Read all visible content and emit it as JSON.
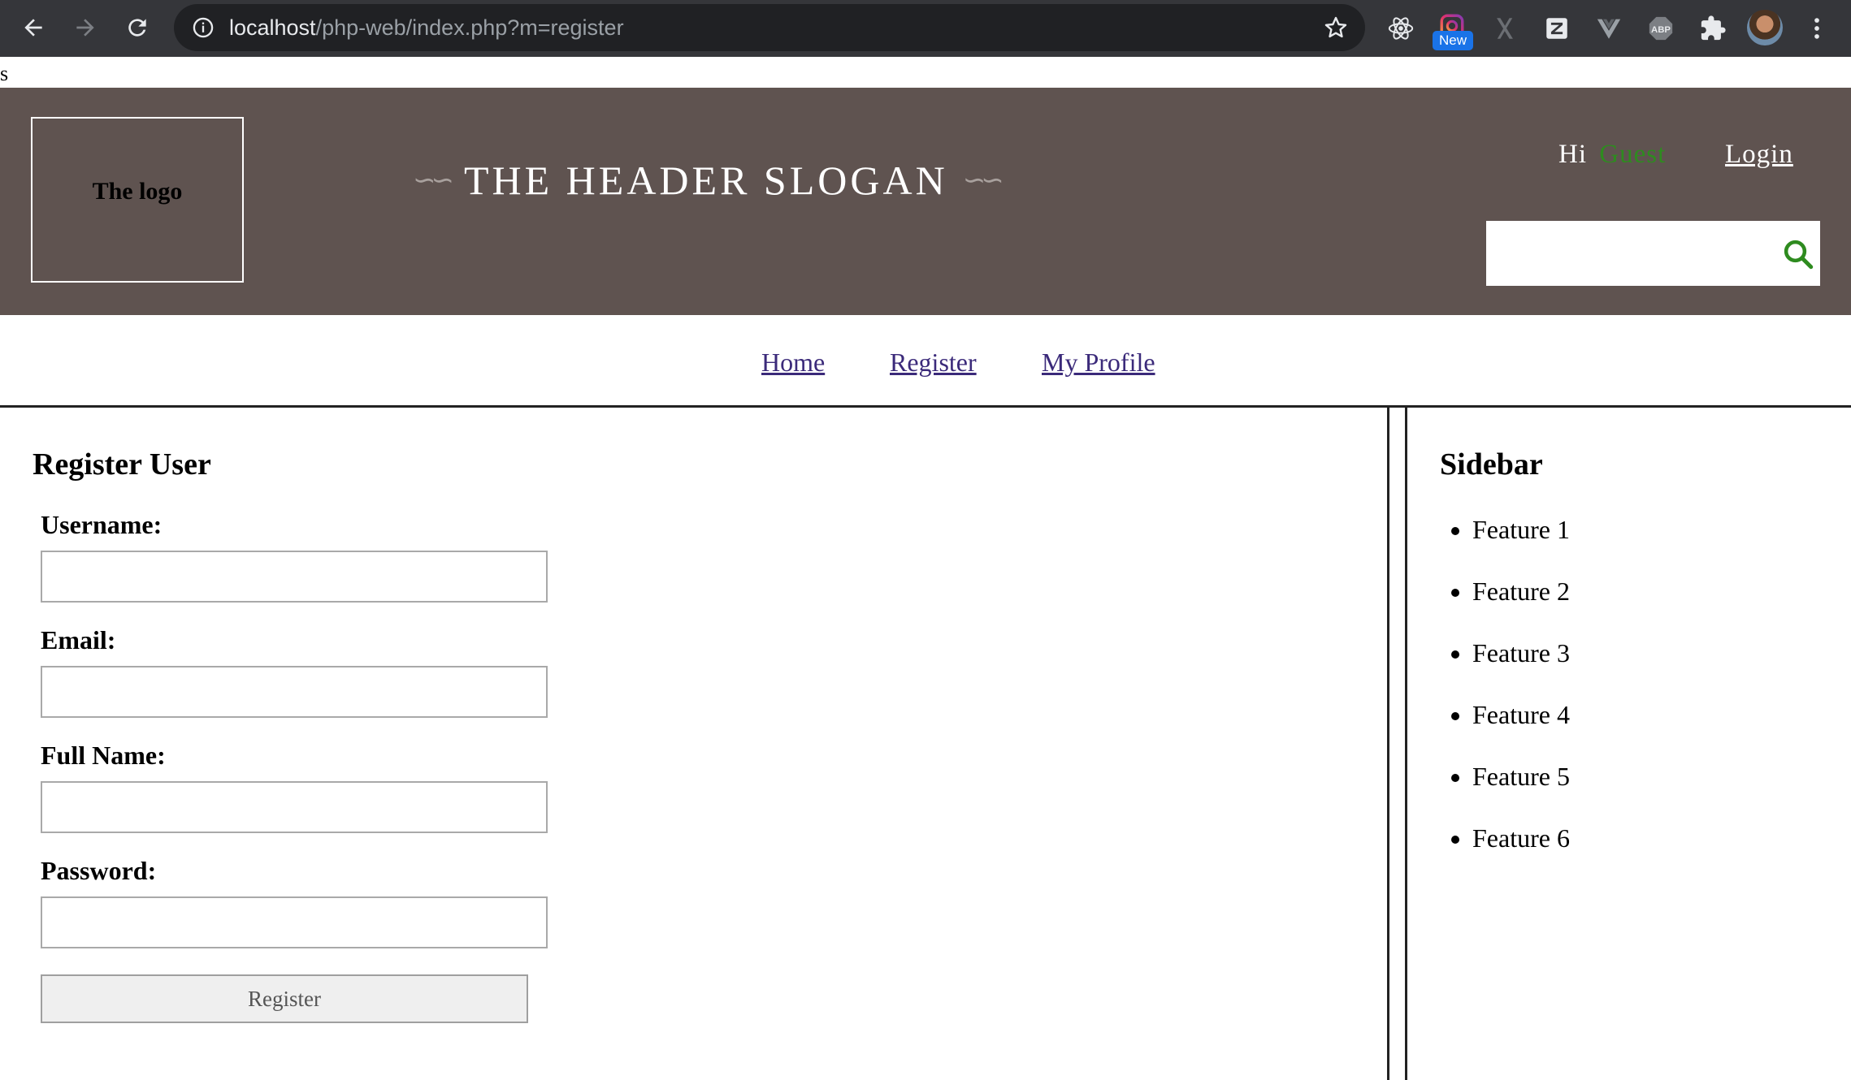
{
  "browser": {
    "url_host": "localhost",
    "url_path": "/php-web/index.php?m=register",
    "new_badge": "New",
    "icons": [
      "back-icon",
      "forward-icon",
      "reload-icon",
      "info-icon",
      "star-icon",
      "react-devtools-icon",
      "instagram-icon",
      "x-icon",
      "zotero-icon",
      "vue-icon",
      "adblock-icon",
      "extensions-icon",
      "avatar",
      "menu-icon"
    ]
  },
  "page": {
    "stray_text": "s",
    "header": {
      "logo_text": "The logo",
      "slogan": "THE HEADER SLOGAN",
      "slogan_ornament": "∽∽",
      "greeting": "Hi",
      "guest": "Guest",
      "login": "Login",
      "search_placeholder": ""
    },
    "nav": {
      "items": [
        {
          "label": "Home"
        },
        {
          "label": "Register"
        },
        {
          "label": "My Profile"
        }
      ]
    },
    "form": {
      "title": "Register User",
      "fields": [
        {
          "label": "Username:",
          "value": ""
        },
        {
          "label": "Email:",
          "value": ""
        },
        {
          "label": "Full Name:",
          "value": ""
        },
        {
          "label": "Password:",
          "value": ""
        }
      ],
      "submit_label": "Register"
    },
    "sidebar": {
      "title": "Sidebar",
      "items": [
        "Feature 1",
        "Feature 2",
        "Feature 3",
        "Feature 4",
        "Feature 5",
        "Feature 6"
      ]
    }
  },
  "colors": {
    "header_bg": "#5f5350",
    "guest": "#2e8b1f",
    "nav_link": "#3b2a7a",
    "chrome_bg": "#35363a"
  }
}
